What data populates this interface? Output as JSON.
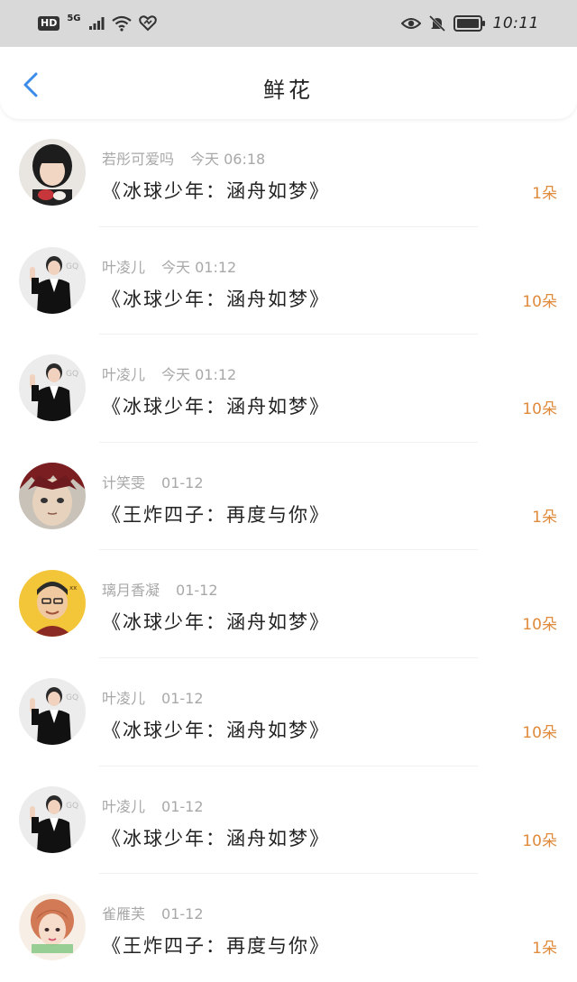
{
  "status_bar": {
    "hd": "HD",
    "network": "5G",
    "time": "10:11",
    "icons": [
      "signal-icon",
      "wifi-icon",
      "heart-icon",
      "eye-icon",
      "mute-icon",
      "battery-icon"
    ]
  },
  "header": {
    "title": "鲜花",
    "back_icon": "chevron-left-icon",
    "accent_color": "#3b8be8"
  },
  "count_color": "#e08a3c",
  "rows": [
    {
      "user": "若彤可爱吗",
      "time": "今天 06:18",
      "book": "《冰球少年：涵舟如梦》",
      "count": "1朵",
      "avatar": "girl-avatar"
    },
    {
      "user": "叶凌儿",
      "time": "今天 01:12",
      "book": "《冰球少年：涵舟如梦》",
      "count": "10朵",
      "avatar": "man-in-suit-avatar"
    },
    {
      "user": "叶凌儿",
      "time": "今天 01:12",
      "book": "《冰球少年：涵舟如梦》",
      "count": "10朵",
      "avatar": "man-in-suit-avatar"
    },
    {
      "user": "计笑雯",
      "time": "01-12",
      "book": "《王炸四子：再度与你》",
      "count": "1朵",
      "avatar": "anime-boy-avatar"
    },
    {
      "user": "璃月香凝",
      "time": "01-12",
      "book": "《冰球少年：涵舟如梦》",
      "count": "10朵",
      "avatar": "cartoon-man-avatar"
    },
    {
      "user": "叶凌儿",
      "time": "01-12",
      "book": "《冰球少年：涵舟如梦》",
      "count": "10朵",
      "avatar": "man-in-suit-avatar"
    },
    {
      "user": "叶凌儿",
      "time": "01-12",
      "book": "《冰球少年：涵舟如梦》",
      "count": "10朵",
      "avatar": "man-in-suit-avatar"
    },
    {
      "user": "雀雁芙",
      "time": "01-12",
      "book": "《王炸四子：再度与你》",
      "count": "1朵",
      "avatar": "girl-illustration-avatar"
    }
  ]
}
